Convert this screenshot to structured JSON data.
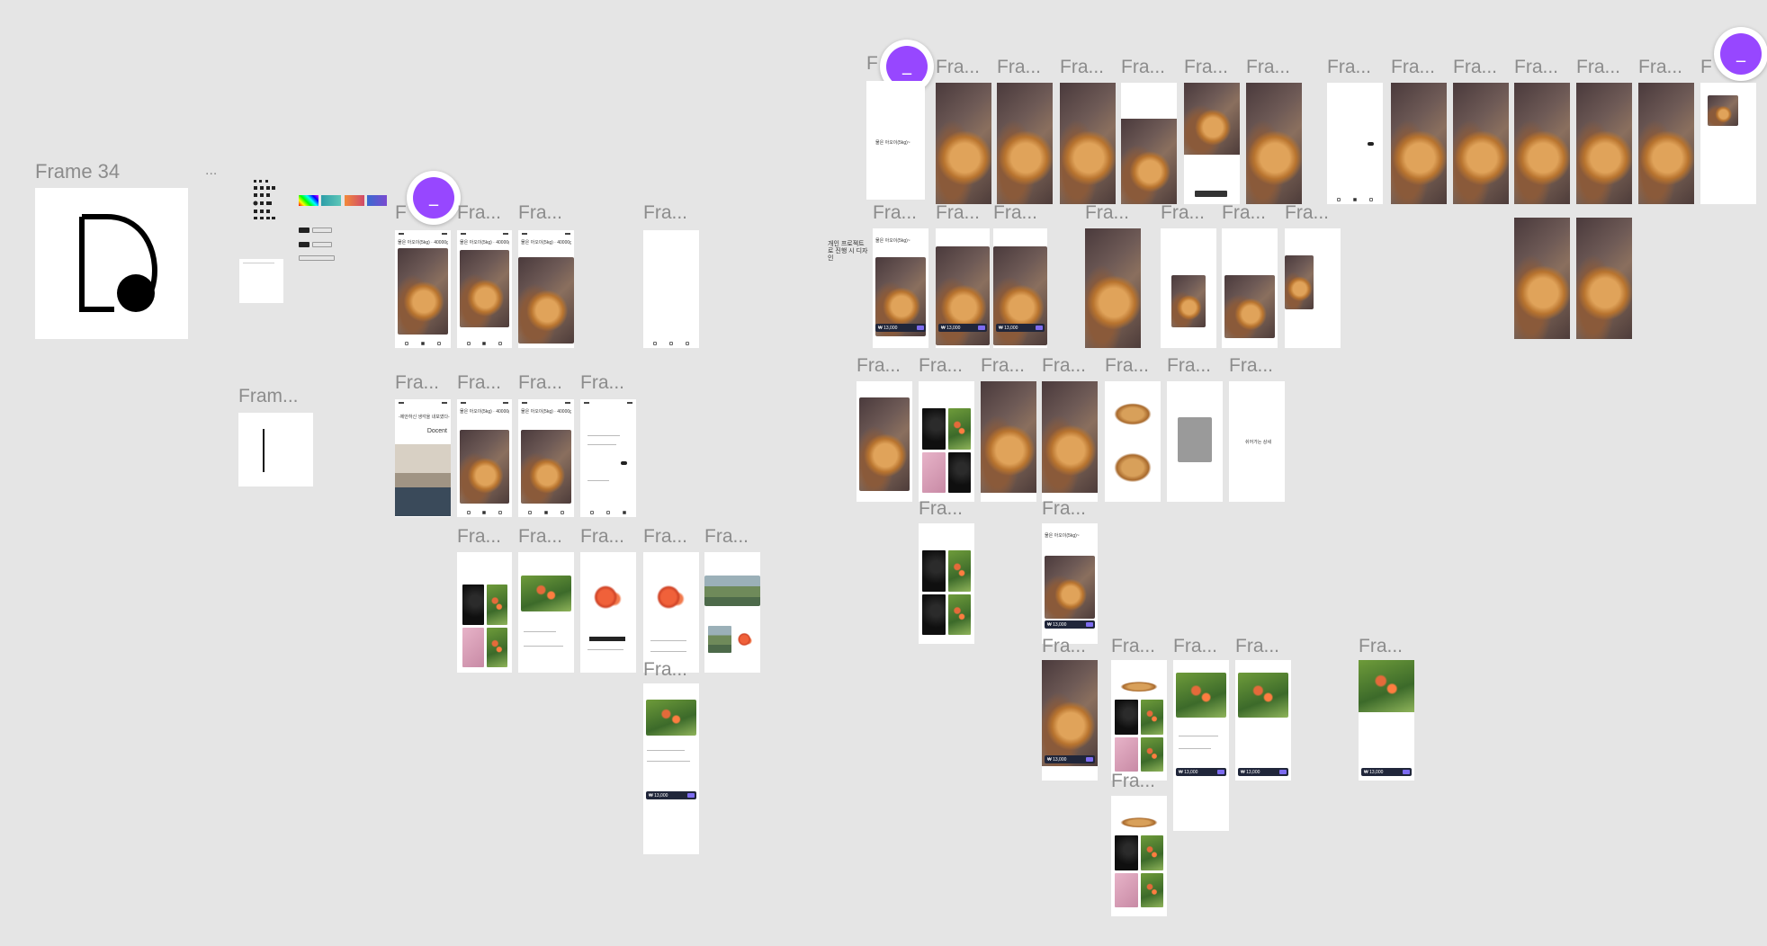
{
  "canvas": {
    "background": "#e5e5e5",
    "label_color": "#8c8c8c",
    "accent": "#9747ff"
  },
  "labels": {
    "frame34": "Frame 34",
    "ellipsis": "...",
    "frame_short": "Fram...",
    "fra": "Fra...",
    "f": "F"
  },
  "presence": {
    "avatar_glyph": "_"
  },
  "screens": {
    "header_pear": "물은 아오이(5kg) · 40000g",
    "header_pear_short": "물은 아오이(5kg)~",
    "price": "₩ 13,000",
    "docent_title": "개인 프로젝트로 진행 시 디자인",
    "docent_brand": "Docent",
    "docent_sub": "-제안하신 생각을 내보였다-",
    "mid_label": "쉬어가는 상세"
  }
}
